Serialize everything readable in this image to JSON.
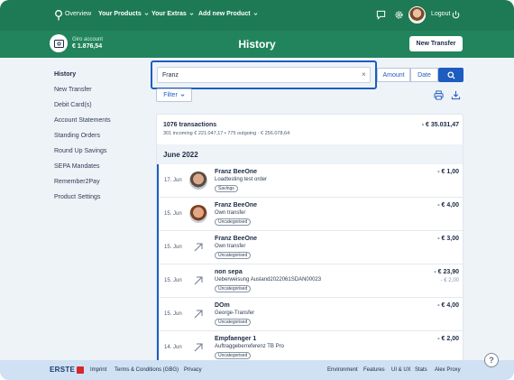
{
  "nav": {
    "overview": "Overview",
    "your_products": "Your Products",
    "your_extras": "Your Extras",
    "add_new_product": "Add new Product",
    "logout": "Logout"
  },
  "account": {
    "name": "Giro account",
    "balance": "€ 1.876,54"
  },
  "page_title": "History",
  "new_transfer_button": "New Transfer",
  "sidebar": {
    "items": [
      {
        "label": "History",
        "active": true
      },
      {
        "label": "New Transfer"
      },
      {
        "label": "Debit Card(s)"
      },
      {
        "label": "Account Statements"
      },
      {
        "label": "Standing Orders"
      },
      {
        "label": "Round Up Savings"
      },
      {
        "label": "SEPA Mandates"
      },
      {
        "label": "Remember2Pay"
      },
      {
        "label": "Product Settings"
      }
    ]
  },
  "search": {
    "value": "Franz",
    "clear": "×",
    "amount_label": "Amount",
    "date_label": "Date"
  },
  "filter_label": "Filter",
  "summary": {
    "title": "1076 transactions",
    "subtitle": "301 incoming € 221.047,17 • 775 outgoing · € 256.078,64",
    "total": "- € 35.031,47"
  },
  "month": "June 2022",
  "transactions": [
    {
      "date": "17. Jun",
      "name": "Franz BeeOne",
      "desc": "Loadtesting test order",
      "tag": "Savings",
      "amount": "- € 1,00",
      "amount2": "",
      "avatar": "photo-male-1"
    },
    {
      "date": "15. Jun",
      "name": "Franz BeeOne",
      "desc": "Own transfer",
      "tag": "Uncategorised",
      "amount": "- € 4,00",
      "amount2": "",
      "avatar": "photo-male-2"
    },
    {
      "date": "15. Jun",
      "name": "Franz BeeOne",
      "desc": "Own transfer",
      "tag": "Uncategorised",
      "amount": "- € 3,00",
      "amount2": "",
      "avatar": "arrow-out-icon"
    },
    {
      "date": "15. Jun",
      "name": "non sepa",
      "desc": "Ueberweisung Ausland2022061SDAN00023",
      "tag": "Uncategorised",
      "amount": "- € 23,90",
      "amount2": "- € 2,00",
      "avatar": "arrow-out-icon"
    },
    {
      "date": "15. Jun",
      "name": "DOm",
      "desc": "George-Transfer",
      "tag": "Uncategorised",
      "amount": "- € 4,00",
      "amount2": "",
      "avatar": "arrow-out-icon"
    },
    {
      "date": "14. Jun",
      "name": "Empfaenger 1",
      "desc": "Auftraggeberreferenz TB Pro",
      "tag": "Uncategorised",
      "amount": "- € 2,00",
      "amount2": "",
      "avatar": "arrow-out-icon"
    }
  ],
  "footer": {
    "brand": "ERSTE",
    "imprint": "Imprint",
    "terms": "Terms & Conditions (GBG)",
    "privacy": "Privacy",
    "environment": "Environment",
    "features": "Features",
    "ui_ux": "UI & UX",
    "stats": "Stats",
    "alex_proxy": "Alex Proxy"
  },
  "help": "?",
  "colors": {
    "nav_green": "#1d7a55",
    "header_green": "#22845c",
    "accent_blue": "#1f5cbf",
    "footer_blue": "#cfe1f2",
    "erste_red": "#d8262c"
  }
}
